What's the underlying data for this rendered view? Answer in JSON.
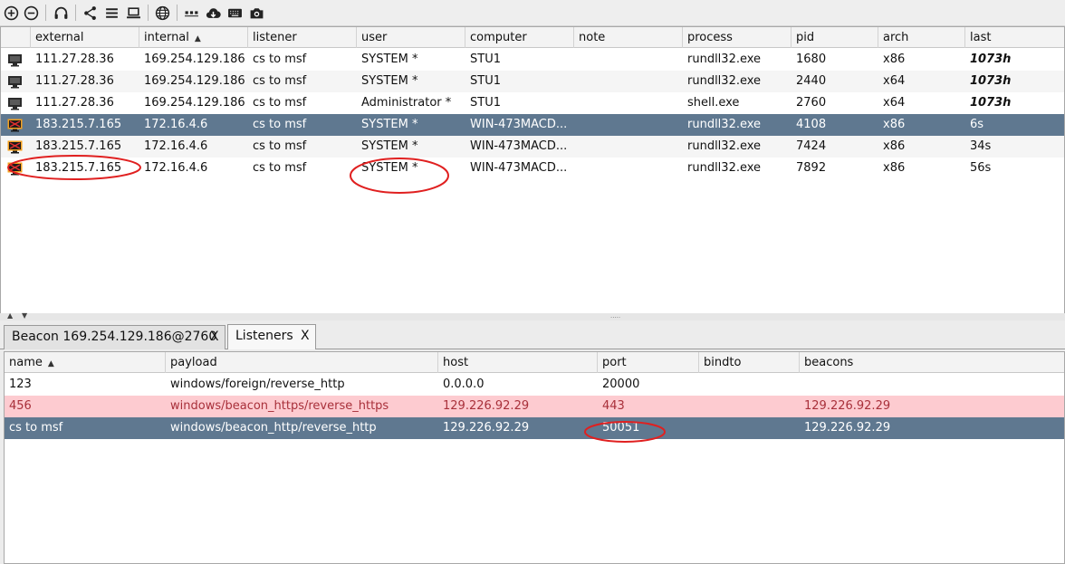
{
  "toolbar": {
    "icons": [
      "new-connection-icon",
      "disconnect-icon",
      "headset-icon",
      "share-icon",
      "list-icon",
      "laptop-icon",
      "globe-icon",
      "dots-icon",
      "cloud-download-icon",
      "keyboard-icon",
      "camera-icon"
    ]
  },
  "beacons": {
    "columns": [
      "external",
      "internal",
      "listener",
      "user",
      "computer",
      "note",
      "process",
      "pid",
      "arch",
      "last"
    ],
    "sort_glyph": "▲",
    "rows": [
      {
        "external": "111.27.28.36",
        "internal": "169.254.129.186",
        "listener": "cs to msf",
        "user": "SYSTEM *",
        "computer": "STU1",
        "note": "",
        "process": "rundll32.exe",
        "pid": "1680",
        "arch": "x86",
        "last": "1073h"
      },
      {
        "external": "111.27.28.36",
        "internal": "169.254.129.186",
        "listener": "cs to msf",
        "user": "SYSTEM *",
        "computer": "STU1",
        "note": "",
        "process": "rundll32.exe",
        "pid": "2440",
        "arch": "x64",
        "last": "1073h"
      },
      {
        "external": "111.27.28.36",
        "internal": "169.254.129.186",
        "listener": "cs to msf",
        "user": "Administrator *",
        "computer": "STU1",
        "note": "",
        "process": "shell.exe",
        "pid": "2760",
        "arch": "x64",
        "last": "1073h"
      },
      {
        "external": "183.215.7.165",
        "internal": "172.16.4.6",
        "listener": "cs to msf",
        "user": "SYSTEM *",
        "computer": "WIN-473MACD...",
        "note": "",
        "process": "rundll32.exe",
        "pid": "4108",
        "arch": "x86",
        "last": "6s"
      },
      {
        "external": "183.215.7.165",
        "internal": "172.16.4.6",
        "listener": "cs to msf",
        "user": "SYSTEM *",
        "computer": "WIN-473MACD...",
        "note": "",
        "process": "rundll32.exe",
        "pid": "7424",
        "arch": "x86",
        "last": "34s"
      },
      {
        "external": "183.215.7.165",
        "internal": "172.16.4.6",
        "listener": "cs to msf",
        "user": "SYSTEM *",
        "computer": "WIN-473MACD...",
        "note": "",
        "process": "rundll32.exe",
        "pid": "7892",
        "arch": "x86",
        "last": "56s"
      }
    ]
  },
  "tabs": [
    {
      "label": "Beacon 169.254.129.186@2760",
      "close": "X"
    },
    {
      "label": "Listeners",
      "close": "X"
    }
  ],
  "listeners": {
    "columns": [
      "name",
      "payload",
      "host",
      "port",
      "bindto",
      "beacons"
    ],
    "sort_glyph": "▲",
    "rows": [
      {
        "name": "123",
        "payload": "windows/foreign/reverse_http",
        "host": "0.0.0.0",
        "port": "20000",
        "bindto": "",
        "beacons": ""
      },
      {
        "name": "456",
        "payload": "windows/beacon_https/reverse_https",
        "host": "129.226.92.29",
        "port": "443",
        "bindto": "",
        "beacons": "129.226.92.29"
      },
      {
        "name": "cs to msf",
        "payload": "windows/beacon_http/reverse_http",
        "host": "129.226.92.29",
        "port": "50051",
        "bindto": "",
        "beacons": "129.226.92.29"
      }
    ]
  },
  "colors": {
    "selected_row": "#5f7890",
    "highlight_row": "#fdcbd0",
    "annotation": "#e02020"
  }
}
